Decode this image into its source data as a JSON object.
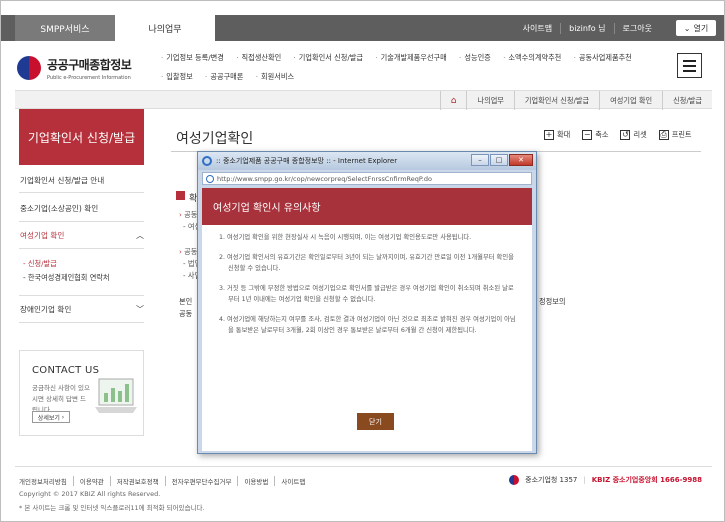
{
  "topbar": {
    "tab_smpp": "SMPP서비스",
    "tab_my": "나의업무",
    "links": [
      "사이트맵",
      "bizinfo 님",
      "로그아웃"
    ],
    "open_label": "열기"
  },
  "logo": {
    "title": "공공구매종합정보",
    "subtitle": "Public e-Procurement Information"
  },
  "gnb": [
    "기업정보 등록/변경",
    "직접생산확인",
    "기업확인서 신청/발급",
    "기술개발제품우선구매",
    "성능인증",
    "소액수의계약추천",
    "공동사업제품추천",
    "입찰정보",
    "공공구매론",
    "회원서비스"
  ],
  "breadcrumb": [
    "나의업무",
    "기업확인서 신청/발급",
    "여성기업 확인",
    "신청/발급"
  ],
  "sidebar": {
    "heading": "기업확인서 신청/발급",
    "items": [
      {
        "label": "기업확인서 신청/발급 안내"
      },
      {
        "label": "중소기업(소상공인) 확인"
      },
      {
        "label": "여성기업 확인"
      },
      {
        "label": "장애인기업 확인"
      }
    ],
    "subitems": [
      "신청/발급",
      "한국여성경제인협회 연락처"
    ],
    "contact": {
      "title": "CONTACT US",
      "desc": "궁금하신 사항이 있으시면 상세히 답변 드립니다.",
      "button": "상세보기"
    }
  },
  "main": {
    "title": "여성기업확인",
    "tools": [
      "확대",
      "축소",
      "리셋",
      "프린트"
    ],
    "bg": {
      "heading": "확",
      "l1": "공동",
      "l1s": "- 여성",
      "l2": "공동",
      "l2s1": "- 법인",
      "l2s2": "- 사업",
      "l3a": "본인",
      "l3b": "공동",
      "l3r": "정정보의"
    }
  },
  "popup": {
    "window_title": ":: 중소기업제품 공공구매 종합정보망 :: - Internet Explorer",
    "url": "http://www.smpp.go.kr/cop/newcorpreq/SelectFnrssCnfirmReqP.do",
    "heading": "여성기업 확인시 유의사항",
    "notices": [
      "1. 여성기업 확인을 위한 현장실사 시 녹음이 시행되며, 이는 여성기업 확인용도로만 사용됩니다.",
      "2. 여성기업 확인서의 유효기간은 확인일로부터 3년이 되는 날까지이며, 유효기간 만료일 이전 1개월부터 확인을 신청할 수 있습니다.",
      "3. 거짓 등 그밖에 부정한 방법으로 여성기업으로 확인서를 발급받은 경우 여성기업 확인이 취소되며 취소된 날로부터 1년 이내에는 여성기업 확인을 신청할 수 없습니다.",
      "4. 여성기업에 해당하는지 여부를 조사, 검토한 결과 여성기업이 아닌 것으로 최초로 밝혀진 경우 여성기업이 아님을 통보받은 날로부터 3개월, 2회 이상인 경우 통보받은 날로부터 6개월 간 신청이 제한됩니다."
    ],
    "close_button": "닫기"
  },
  "footer": {
    "links": [
      "개인정보처리방침",
      "이용약관",
      "저작권보호정책",
      "전자우편무단수집거부",
      "이용방법",
      "사이트맵"
    ],
    "copyright": "Copyright © 2017 KBIZ All rights Reserved.",
    "note": "* 본 사이트는 크롬 및 인터넷 익스플로러11에 최적화 되어있습니다.",
    "callcenter_label": "중소기업청 1357",
    "kbiz_label": "KBIZ 중소기업중앙회 1666-9988"
  }
}
